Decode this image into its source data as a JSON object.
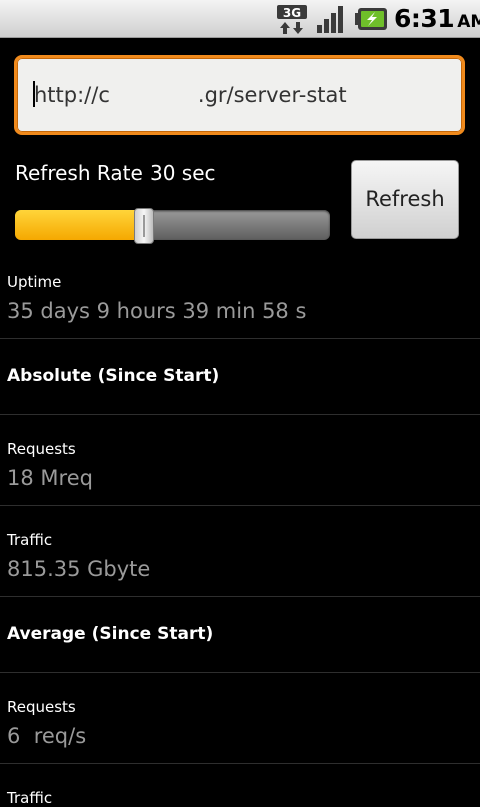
{
  "status_bar": {
    "network_icon": "3g-data-icon",
    "network_text": "3G",
    "signal_icon": "signal-strength-icon",
    "battery_icon": "battery-charging-icon",
    "time": "6:31",
    "ampm": "AM"
  },
  "url_input": {
    "value_start": "http://c",
    "value_end": ".gr/server-stat"
  },
  "refresh": {
    "label": "Refresh Rate",
    "value": "30 sec",
    "button_label": "Refresh",
    "slider_fraction": 0.41,
    "slider_fill_color": "#f5b800"
  },
  "stats": {
    "uptime_label": "Uptime",
    "uptime_value": "35 days 9 hours 39 min 58 s",
    "absolute_header": "Absolute (Since Start)",
    "abs_requests_label": "Requests",
    "abs_requests_value": "18 Mreq",
    "abs_traffic_label": "Traffic",
    "abs_traffic_value": "815.35 Gbyte",
    "average_header": "Average (Since Start)",
    "avg_requests_label": "Requests",
    "avg_requests_value": "6  req/s",
    "avg_traffic_label": "Traffic"
  }
}
